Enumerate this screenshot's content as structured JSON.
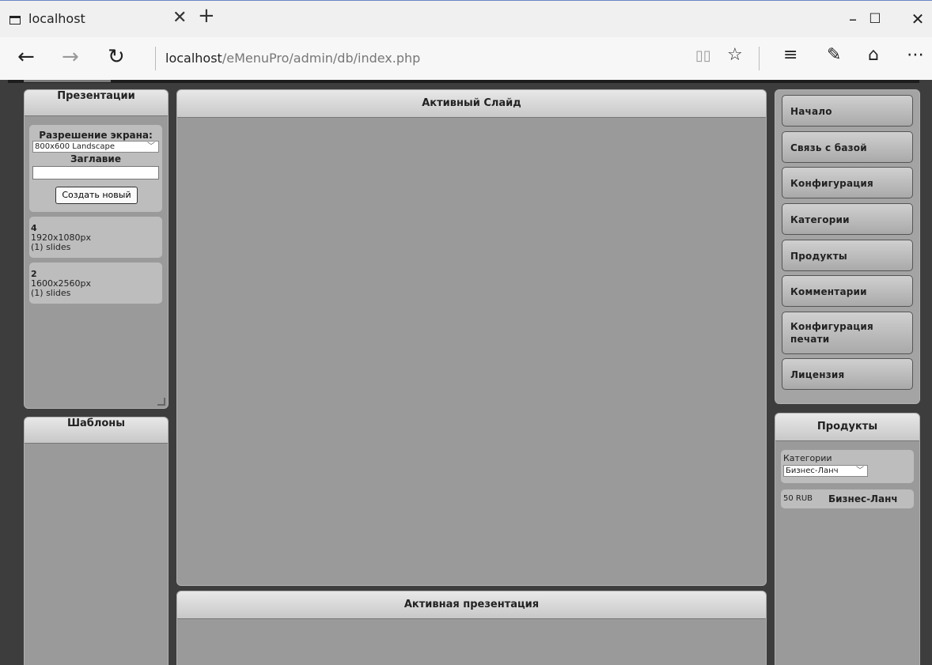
{
  "browser": {
    "tab_title": "localhost",
    "url_host": "localhost",
    "url_path": "/eMenuPro/admin/db/index.php"
  },
  "left": {
    "presentations_header": "Презентации",
    "resolution_label": "Разрешение экрана:",
    "resolution_value": "800x600 Landscape",
    "title_label": "Заглавие",
    "title_value": "",
    "create_button": "Создать новый",
    "presentations": [
      {
        "id": "4",
        "resolution": "1920x1080px",
        "slides": "(1) slides"
      },
      {
        "id": "2",
        "resolution": "1600x2560px",
        "slides": "(1) slides"
      }
    ],
    "templates_header": "Шаблоны"
  },
  "center": {
    "active_slide_header": "Активный Слайд",
    "active_presentation_header": "Активная презентация"
  },
  "right": {
    "menu": [
      "Начало",
      "Связь с базой",
      "Конфигурация",
      "Категории",
      "Продукты",
      "Комментарии",
      "Конфигурация печати",
      "Лицензия"
    ],
    "products_header": "Продукты",
    "categories_label": "Категории",
    "category_value": "Бизнес-Ланч",
    "product": {
      "price": "50 RUB",
      "name": "Бизнес-Ланч"
    }
  }
}
